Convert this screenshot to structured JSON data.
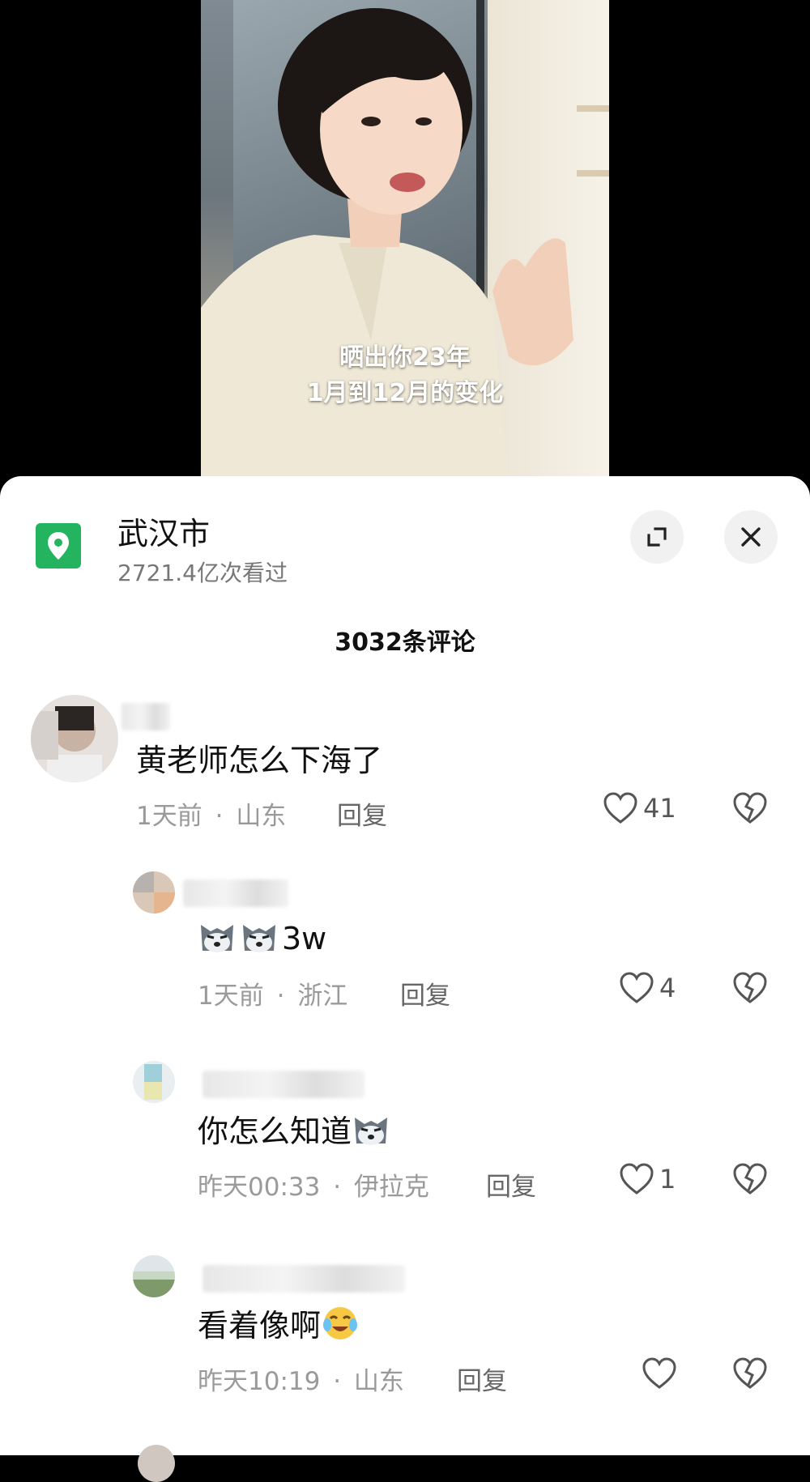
{
  "video": {
    "caption_line1": "晒出你23年",
    "caption_line2": "1月到12月的变化"
  },
  "location": {
    "title": "武汉市",
    "views": "2721.4亿次看过",
    "icon": "location-pin-icon"
  },
  "controls": {
    "expand_icon": "expand-icon",
    "close_icon": "close-icon"
  },
  "comments_header": "3032条评论",
  "comments": [
    {
      "text": "黄老师怎么下海了",
      "time": "1天前",
      "region": "山东",
      "reply_label": "回复",
      "likes": "41"
    },
    {
      "emoji": "doge-emoji",
      "text": "3w",
      "time": "1天前",
      "region": "浙江",
      "reply_label": "回复",
      "likes": "4"
    },
    {
      "text": "你怎么知道",
      "emoji": "doge-emoji",
      "time": "昨天00:33",
      "region": "伊拉克",
      "reply_label": "回复",
      "likes": "1"
    },
    {
      "text": "看着像啊",
      "emoji": "crying-laughing-emoji",
      "time": "昨天10:19",
      "region": "山东",
      "reply_label": "回复",
      "likes": ""
    }
  ],
  "separator": "·",
  "colors": {
    "location_green": "#24b35e",
    "meta_gray": "#9a9a9a",
    "sheet_bg": "#ffffff"
  }
}
